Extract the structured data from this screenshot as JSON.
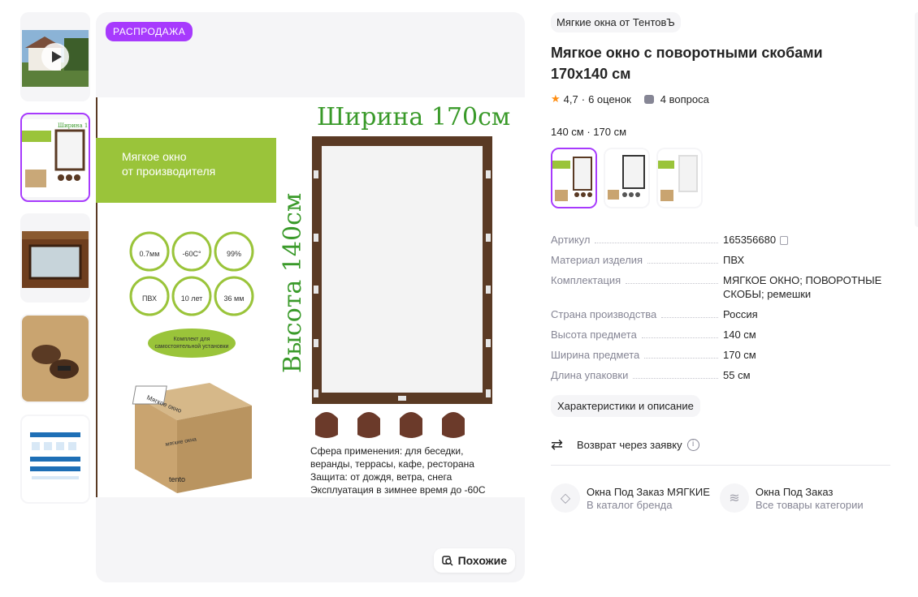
{
  "main_image": {
    "badge": "РАСПРОДАЖА",
    "similar_button": "Похожие",
    "poster": {
      "width_label": "Ширина 170см",
      "height_label": "Высота 140см",
      "maker_text": "Мягкое окно\nот производителя",
      "feature_icons": [
        {
          "value": "0.7мм"
        },
        {
          "value": "-60С°"
        },
        {
          "value": "99%"
        },
        {
          "value": "ПВХ"
        },
        {
          "value": "10 лет"
        },
        {
          "value": "36 мм"
        }
      ],
      "kit_badge": "Комплект для самостоятельной установки",
      "box_title": "Мягкое окно",
      "box_sub": "мягкие окна от производителя",
      "box_brand": "tento",
      "desc_lines": [
        "Сфера применения: для беседки,",
        "веранды, террасы, кафе, ресторана",
        "Защита: от дождя, ветра, снега",
        "Эксплуатация в зимнее время до -60С"
      ]
    }
  },
  "product": {
    "brand_chip": "Мягкие окна от ТентовЪ",
    "title": "Мягкое окно с поворотными скобами 170x140 см",
    "rating": "4,7",
    "ratings_count": "6 оценок",
    "questions": "4 вопроса",
    "size_selected": "140 см · 170 см"
  },
  "specs": [
    {
      "key": "Артикул",
      "value": "165356680"
    },
    {
      "key": "Материал изделия",
      "value": "ПВХ"
    },
    {
      "key": "Комплектация",
      "value": "МЯГКОЕ ОКНО; ПОВОРОТНЫЕ СКОБЫ; ремешки"
    },
    {
      "key": "Страна производства",
      "value": "Россия"
    },
    {
      "key": "Высота предмета",
      "value": "140 см"
    },
    {
      "key": "Ширина предмета",
      "value": "170 см"
    },
    {
      "key": "Длина упаковки",
      "value": "55 см"
    }
  ],
  "char_button": "Характеристики и описание",
  "return_text": "Возврат через заявку",
  "links": [
    {
      "title": "Окна Под Заказ МЯГКИЕ",
      "sub": "В каталог бренда"
    },
    {
      "title": "Окна Под Заказ",
      "sub": "Все товары категории"
    }
  ],
  "colors": {
    "accent": "#a73afd",
    "star": "#ff8d11",
    "poster_green": "#3a9a2a",
    "poster_lime": "#9ac43a",
    "frame_brown": "#5a3a24"
  }
}
